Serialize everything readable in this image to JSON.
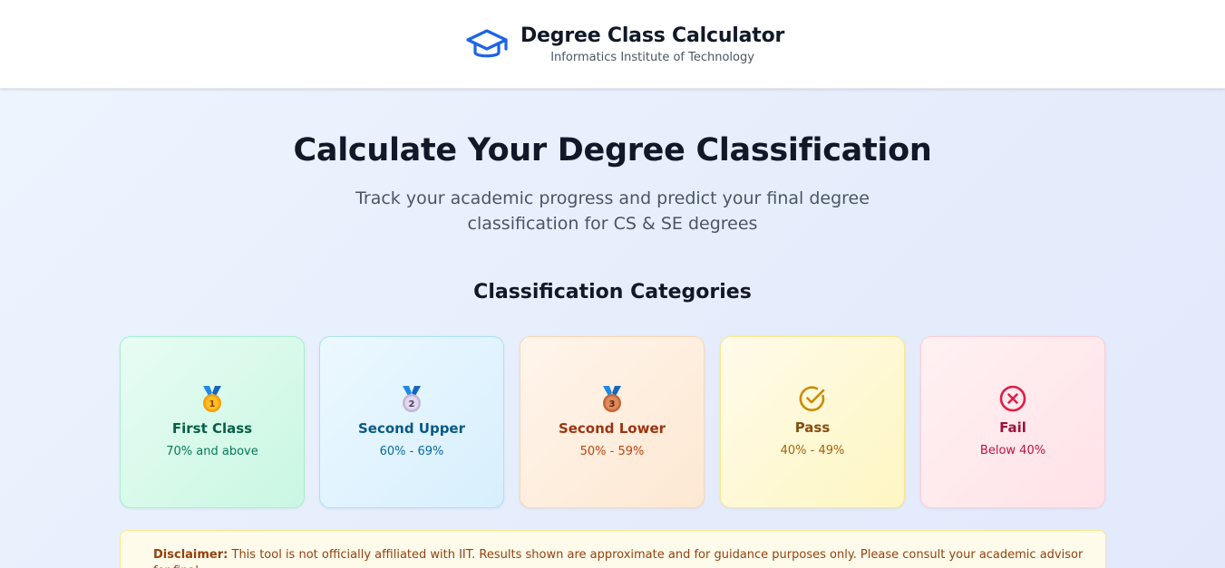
{
  "header": {
    "title": "Degree Class Calculator",
    "subtitle": "Informatics Institute of Technology",
    "logo_icon": "graduation-cap-icon",
    "accent_color": "#1d63e6"
  },
  "hero": {
    "title": "Calculate Your Degree Classification",
    "subtitle": "Track your academic progress and predict your final degree classification for CS & SE degrees"
  },
  "categories": {
    "title": "Classification Categories",
    "items": [
      {
        "name": "First Class",
        "range": "70% and above",
        "icon": "gold-medal-icon",
        "color": "#065f46"
      },
      {
        "name": "Second Upper",
        "range": "60% - 69%",
        "icon": "silver-medal-icon",
        "color": "#075985"
      },
      {
        "name": "Second Lower",
        "range": "50% - 59%",
        "icon": "bronze-medal-icon",
        "color": "#9a3412"
      },
      {
        "name": "Pass",
        "range": "40% - 49%",
        "icon": "check-circle-icon",
        "color": "#ca8a04"
      },
      {
        "name": "Fail",
        "range": "Below 40%",
        "icon": "x-circle-icon",
        "color": "#e11d48"
      }
    ]
  },
  "disclaimer": {
    "label": "Disclaimer:",
    "text": "This tool is not officially affiliated with IIT. Results shown are approximate and for guidance purposes only. Please consult your academic advisor for final"
  }
}
